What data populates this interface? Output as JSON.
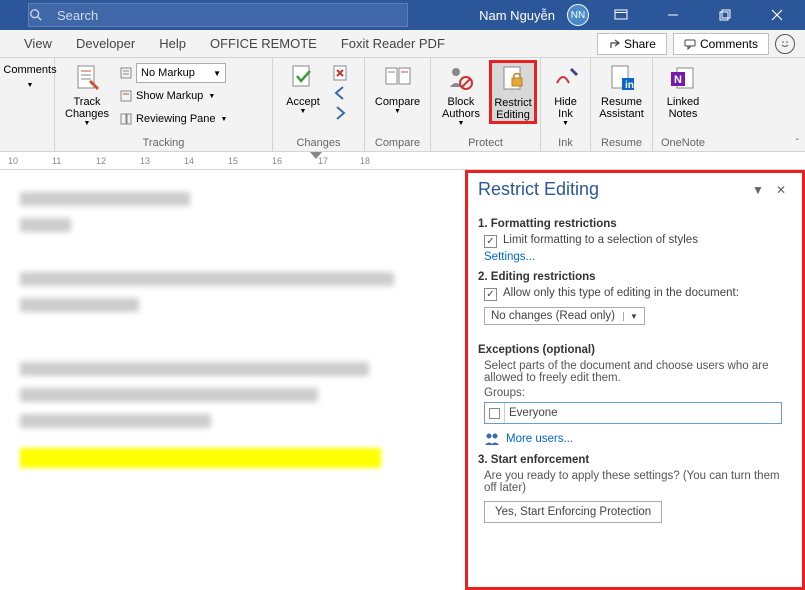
{
  "titlebar": {
    "search_placeholder": "Search",
    "user_name": "Nam Nguyễn",
    "user_initials": "NN"
  },
  "menubar": {
    "items": [
      "View",
      "Developer",
      "Help",
      "OFFICE REMOTE",
      "Foxit Reader PDF"
    ],
    "share": "Share",
    "comments": "Comments"
  },
  "ribbon": {
    "comments": {
      "label": "Comments"
    },
    "tracking": {
      "track_changes": "Track\nChanges",
      "no_markup": "No Markup",
      "show_markup": "Show Markup",
      "reviewing_pane": "Reviewing Pane",
      "group": "Tracking"
    },
    "changes": {
      "accept": "Accept",
      "group": "Changes"
    },
    "compare": {
      "compare": "Compare",
      "group": "Compare"
    },
    "protect": {
      "block_authors": "Block\nAuthors",
      "restrict_editing": "Restrict\nEditing",
      "group": "Protect"
    },
    "ink": {
      "hide_ink": "Hide\nInk",
      "group": "Ink"
    },
    "resume": {
      "resume_assistant": "Resume\nAssistant",
      "group": "Resume"
    },
    "onenote": {
      "linked_notes": "Linked\nNotes",
      "group": "OneNote"
    }
  },
  "ruler": {
    "marks": [
      "10",
      "11",
      "12",
      "13",
      "14",
      "15",
      "16",
      "17",
      "18"
    ]
  },
  "pane": {
    "title": "Restrict Editing",
    "s1_title": "1. Formatting restrictions",
    "s1_check": "Limit formatting to a selection of styles",
    "s1_link": "Settings...",
    "s2_title": "2. Editing restrictions",
    "s2_check": "Allow only this type of editing in the document:",
    "s2_select": "No changes (Read only)",
    "s2_ex_title": "Exceptions (optional)",
    "s2_ex_desc": "Select parts of the document and choose users who are allowed to freely edit them.",
    "s2_groups": "Groups:",
    "s2_everyone": "Everyone",
    "s2_more_users": "More users...",
    "s3_title": "3. Start enforcement",
    "s3_desc": "Are you ready to apply these settings? (You can turn them off later)",
    "s3_button": "Yes, Start Enforcing Protection"
  }
}
